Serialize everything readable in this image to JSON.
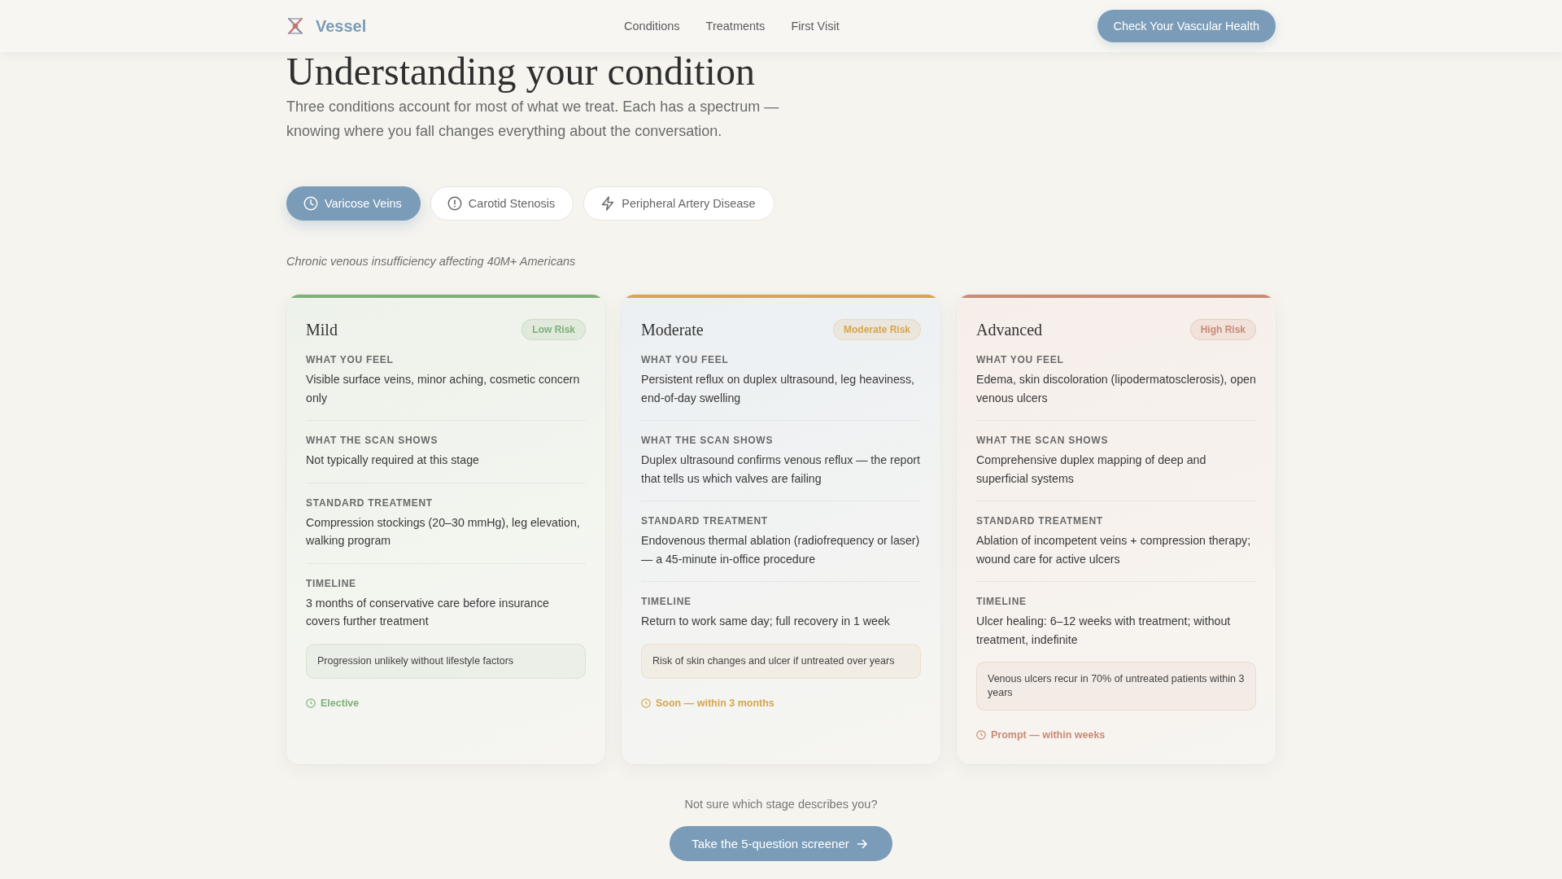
{
  "header": {
    "brand": "Vessel",
    "nav": [
      "Conditions",
      "Treatments",
      "First Visit"
    ],
    "cta": "Check Your Vascular Health"
  },
  "hero": {
    "title": "Understanding your condition",
    "lead": "Three conditions account for most of what we treat. Each has a spectrum — knowing where you fall changes everything about the conversation."
  },
  "tabs": [
    {
      "label": "Varicose Veins",
      "selected": true
    },
    {
      "label": "Carotid Stenosis",
      "selected": false
    },
    {
      "label": "Peripheral Artery Disease",
      "selected": false
    }
  ],
  "condition_summary": "Chronic venous insufficiency affecting 40M+ Americans",
  "stages": [
    {
      "name": "Mild",
      "risk": "Low Risk",
      "color": "#7fb07a",
      "sections": [
        {
          "label": "WHAT YOU FEEL",
          "text": "Visible surface veins, minor aching, cosmetic concern only"
        },
        {
          "label": "WHAT THE SCAN SHOWS",
          "text": "Not typically required at this stage"
        },
        {
          "label": "STANDARD TREATMENT",
          "text": "Compression stockings (20–30 mmHg), leg elevation, walking program"
        },
        {
          "label": "TIMELINE",
          "text": "3 months of conservative care before insurance covers further treatment"
        }
      ],
      "note": "Progression unlikely without lifestyle factors",
      "urgency": "Elective"
    },
    {
      "name": "Moderate",
      "risk": "Moderate Risk",
      "color": "#d6a64f",
      "sections": [
        {
          "label": "WHAT YOU FEEL",
          "text": "Persistent reflux on duplex ultrasound, leg heaviness, end-of-day swelling"
        },
        {
          "label": "WHAT THE SCAN SHOWS",
          "text": "Duplex ultrasound confirms venous reflux — the report that tells us which valves are failing"
        },
        {
          "label": "STANDARD TREATMENT",
          "text": "Endovenous thermal ablation (radiofrequency or laser) — a 45-minute in-office procedure"
        },
        {
          "label": "TIMELINE",
          "text": "Return to work same day; full recovery in 1 week"
        }
      ],
      "note": "Risk of skin changes and ulcer if untreated over years",
      "urgency": "Soon — within 3 months"
    },
    {
      "name": "Advanced",
      "risk": "High Risk",
      "color": "#c98a76",
      "sections": [
        {
          "label": "WHAT YOU FEEL",
          "text": "Edema, skin discoloration (lipodermatosclerosis), open venous ulcers"
        },
        {
          "label": "WHAT THE SCAN SHOWS",
          "text": "Comprehensive duplex mapping of deep and superficial systems"
        },
        {
          "label": "STANDARD TREATMENT",
          "text": "Ablation of incompetent veins + compression therapy; wound care for active ulcers"
        },
        {
          "label": "TIMELINE",
          "text": "Ulcer healing: 6–12 weeks with treatment; without treatment, indefinite"
        }
      ],
      "note": "Venous ulcers recur in 70% of untreated patients within 3 years",
      "urgency": "Prompt — within weeks"
    }
  ],
  "footer": {
    "prompt": "Not sure which stage describes you?",
    "button": "Take the 5-question screener"
  }
}
